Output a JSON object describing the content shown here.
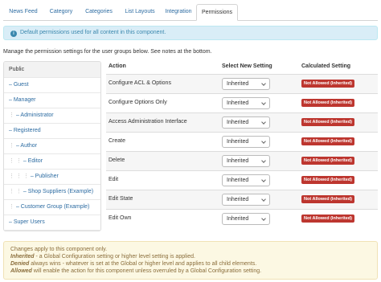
{
  "tabs": [
    {
      "label": "News Feed"
    },
    {
      "label": "Category"
    },
    {
      "label": "Categories"
    },
    {
      "label": "List Layouts"
    },
    {
      "label": "Integration"
    },
    {
      "label": "Permissions"
    }
  ],
  "info": {
    "text": "Default permissions used for all content in this component."
  },
  "intro": "Manage the permission settings for the user groups below. See notes at the bottom.",
  "groups": [
    {
      "label": "Public",
      "prefix": ""
    },
    {
      "label": "– Guest",
      "prefix": ""
    },
    {
      "label": "– Manager",
      "prefix": ""
    },
    {
      "label": "– Administrator",
      "prefix": "⋮"
    },
    {
      "label": "– Registered",
      "prefix": ""
    },
    {
      "label": "– Author",
      "prefix": "⋮"
    },
    {
      "label": "– Editor",
      "prefix": "⋮  ⋮"
    },
    {
      "label": "– Publisher",
      "prefix": "⋮  ⋮  ⋮"
    },
    {
      "label": "– Shop Suppliers (Example)",
      "prefix": "⋮  ⋮"
    },
    {
      "label": "– Customer Group (Example)",
      "prefix": "⋮"
    },
    {
      "label": "– Super Users",
      "prefix": ""
    }
  ],
  "table": {
    "headers": {
      "action": "Action",
      "setting": "Select New Setting",
      "calculated": "Calculated Setting"
    },
    "rows": [
      {
        "action": "Configure ACL & Options",
        "setting": "Inherited",
        "calculated": "Not Allowed (Inherited)"
      },
      {
        "action": "Configure Options Only",
        "setting": "Inherited",
        "calculated": "Not Allowed (Inherited)"
      },
      {
        "action": "Access Administration Interface",
        "setting": "Inherited",
        "calculated": "Not Allowed (Inherited)"
      },
      {
        "action": "Create",
        "setting": "Inherited",
        "calculated": "Not Allowed (Inherited)"
      },
      {
        "action": "Delete",
        "setting": "Inherited",
        "calculated": "Not Allowed (Inherited)"
      },
      {
        "action": "Edit",
        "setting": "Inherited",
        "calculated": "Not Allowed (Inherited)"
      },
      {
        "action": "Edit State",
        "setting": "Inherited",
        "calculated": "Not Allowed (Inherited)"
      },
      {
        "action": "Edit Own",
        "setting": "Inherited",
        "calculated": "Not Allowed (Inherited)"
      }
    ]
  },
  "notes": {
    "line1": "Changes apply to this component only.",
    "inherited_term": "Inherited",
    "inherited_text": " - a Global Configuration setting or higher level setting is applied.",
    "denied_term": "Denied",
    "denied_text": " always wins - whatever is set at the Global or higher level and applies to all child elements.",
    "allowed_term": "Allowed",
    "allowed_text": " will enable the action for this component unless overruled by a Global Configuration setting."
  },
  "colors": {
    "link": "#2d6ca2",
    "badge": "#bd362f",
    "info_bg": "#d9edf7",
    "notes_bg": "#fcf8e3"
  }
}
